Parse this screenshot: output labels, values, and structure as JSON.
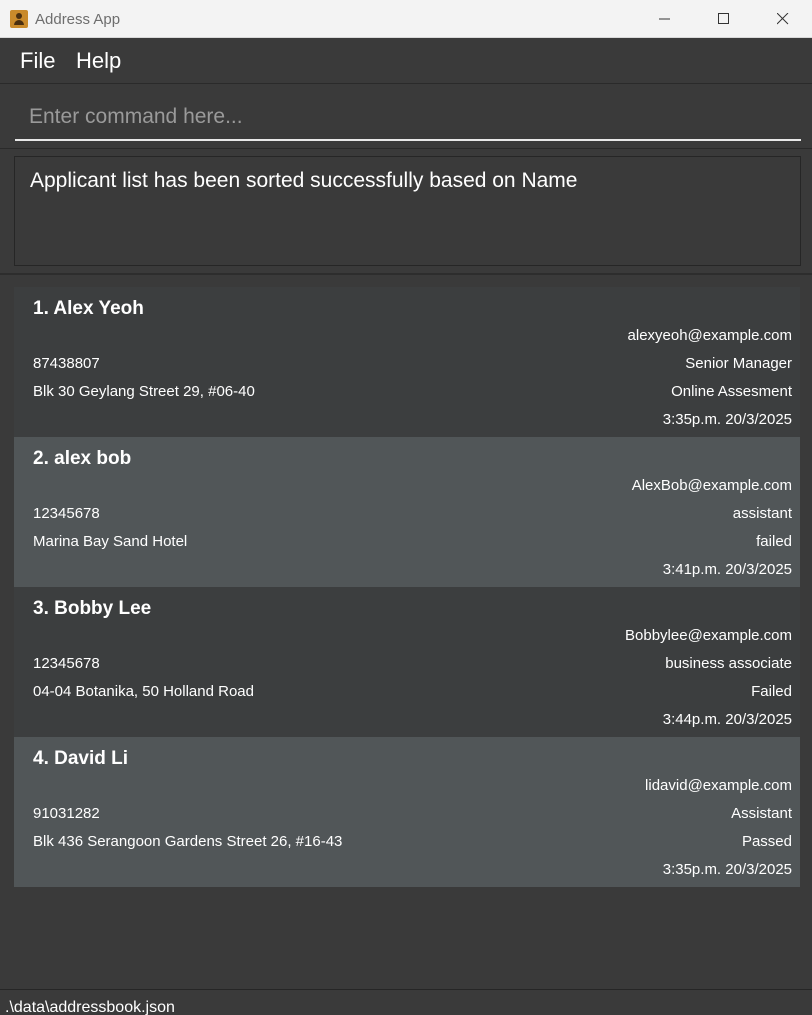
{
  "window": {
    "title": "Address App",
    "icon": "contact-book-icon"
  },
  "menu": {
    "file": "File",
    "help": "Help"
  },
  "command": {
    "placeholder": "Enter command here...",
    "value": ""
  },
  "result": {
    "message": "Applicant list has been sorted successfully based on Name"
  },
  "applicants": [
    {
      "name": "1. Alex Yeoh",
      "email": "alexyeoh@example.com",
      "phone": "87438807",
      "job": "Senior Manager",
      "address": "Blk 30 Geylang Street 29, #06-40",
      "status": "Online Assesment",
      "time": "3:35p.m. 20/3/2025"
    },
    {
      "name": "2. alex bob",
      "email": "AlexBob@example.com",
      "phone": "12345678",
      "job": "assistant",
      "address": "Marina Bay Sand Hotel",
      "status": "failed",
      "time": "3:41p.m. 20/3/2025"
    },
    {
      "name": "3. Bobby Lee",
      "email": "Bobbylee@example.com",
      "phone": "12345678",
      "job": "business associate",
      "address": "04-04 Botanika, 50 Holland Road",
      "status": "Failed",
      "time": "3:44p.m. 20/3/2025"
    },
    {
      "name": "4. David Li",
      "email": "lidavid@example.com",
      "phone": "91031282",
      "job": "Assistant",
      "address": "Blk 436 Serangoon Gardens Street 26, #16-43",
      "status": "Passed",
      "time": "3:35p.m. 20/3/2025"
    }
  ],
  "statusbar": {
    "path": ".\\data\\addressbook.json"
  },
  "colors": {
    "background": "#3a3a3a",
    "card_odd": "#3c3e3f",
    "card_even": "#515658",
    "titlebar": "#f3f3f3"
  }
}
